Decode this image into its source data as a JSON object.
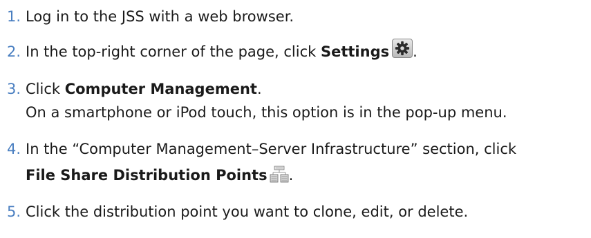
{
  "steps": [
    {
      "number": "1.",
      "text": "Log in to the JSS with a web browser."
    },
    {
      "number": "2.",
      "prefix": "In the top-right corner of the page, click ",
      "term": "Settings",
      "suffix": ".",
      "icon": "gear-icon"
    },
    {
      "number": "3.",
      "prefix": "Click ",
      "term": "Computer Management",
      "suffix": ".",
      "note": "On a smartphone or iPod touch, this option is in the pop-up menu."
    },
    {
      "number": "4.",
      "text": "In the “Computer Management–Server Infrastructure” section, click",
      "term": "File Share Distribution Points",
      "suffix": ".",
      "icon": "file-share-servers-icon"
    },
    {
      "number": "5.",
      "text": "Click the distribution point you want to clone, edit, or delete."
    }
  ],
  "colors": {
    "step_number": "#4a7fc1",
    "body_text": "#1a1a1a"
  }
}
